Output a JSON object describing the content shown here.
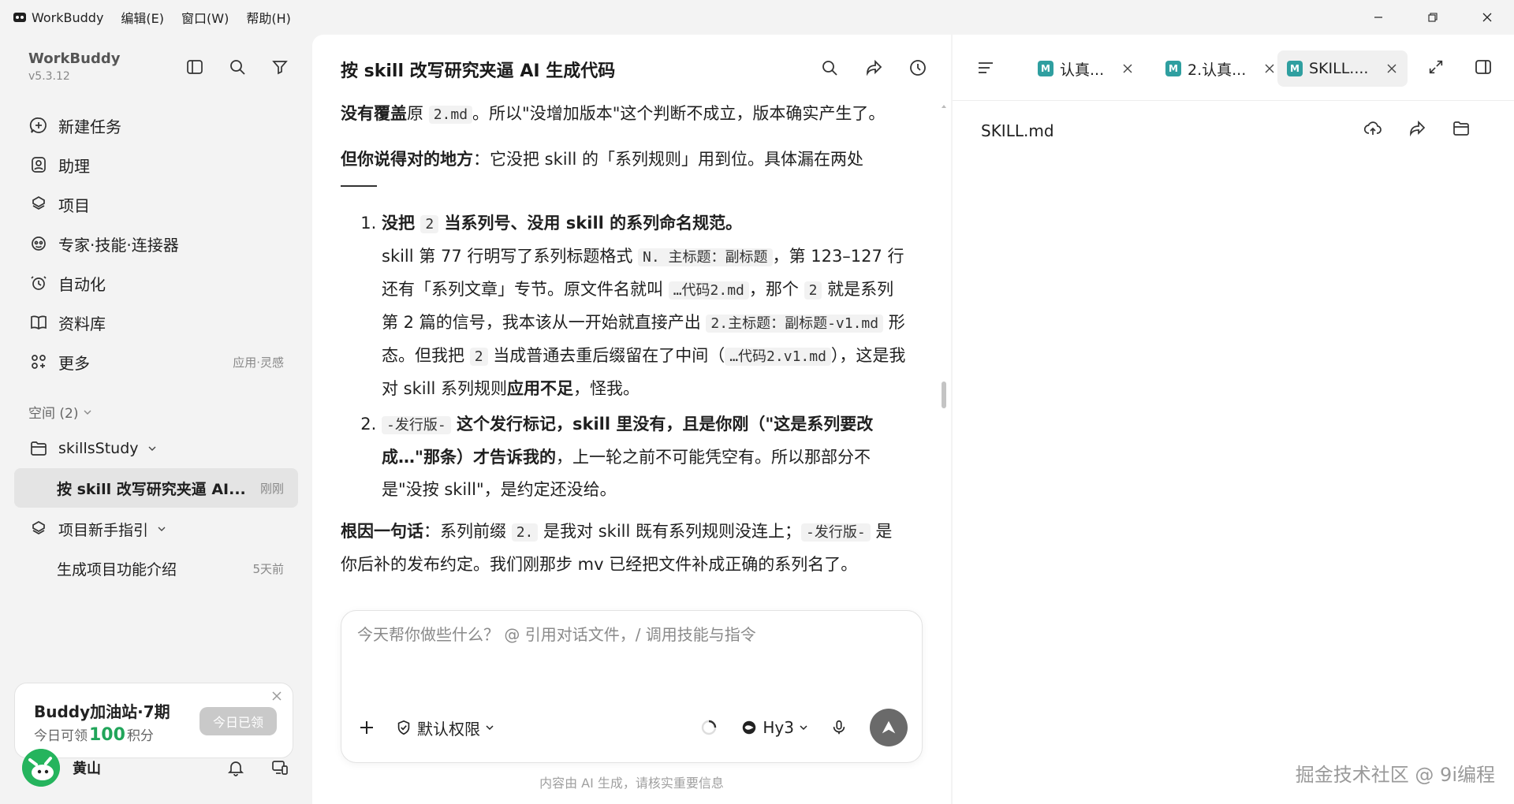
{
  "titlebar": {
    "app_name": "WorkBuddy",
    "menus": [
      "编辑(E)",
      "窗口(W)",
      "帮助(H)"
    ]
  },
  "sidebar": {
    "brand": "WorkBuddy",
    "version": "v5.3.12",
    "nav": [
      {
        "label": "新建任务",
        "icon": "new-task-icon"
      },
      {
        "label": "助理",
        "icon": "assistant-icon"
      },
      {
        "label": "项目",
        "icon": "project-icon"
      },
      {
        "label": "专家·技能·连接器",
        "icon": "experts-icon"
      },
      {
        "label": "自动化",
        "icon": "automation-icon"
      },
      {
        "label": "资料库",
        "icon": "library-icon"
      },
      {
        "label": "更多",
        "icon": "more-icon",
        "hint": "应用·灵感"
      }
    ],
    "space_header": "空间 (2)",
    "workspace": "skillsStudy",
    "active_task": {
      "label": "按 skill 改写研究夹逼 AI...",
      "time": "刚刚"
    },
    "guide": "项目新手指引",
    "guide_task": {
      "label": "生成项目功能介绍",
      "time": "5天前"
    },
    "promo": {
      "title": "Buddy加油站·7期",
      "sub_prefix": "今日可领",
      "points": "100",
      "sub_suffix": "积分",
      "button": "今日已领"
    },
    "user": {
      "name": "黄山"
    }
  },
  "chat": {
    "title": "按 skill 改写研究夹逼 AI 生成代码",
    "p1_bold": "没有覆盖",
    "p1_a": "原 ",
    "p1_code": "2.md",
    "p1_b": "。所以\"没增加版本\"这个判断不成立，版本确实产生了。",
    "p2_bold": "但你说得对的地方",
    "p2_rest": "：它没把 skill 的「系列规则」用到位。具体漏在两处",
    "li1_b1": "没把 ",
    "li1_code": "2",
    "li1_b2": " 当系列号、没用 skill 的系列命名规范。",
    "li1_t1": "skill 第 77 行明写了系列标题格式 ",
    "li1_code2": "N. 主标题：副标题",
    "li1_t2": "，第 123–127 行还有「系列文章」专节。原文件名就叫 ",
    "li1_code3": "…代码2.md",
    "li1_t3": "，那个 ",
    "li1_code4": "2",
    "li1_t4": " 就是系列第 2 篇的信号，我本该从一开始就直接产出 ",
    "li1_code5": "2.主标题：副标题-v1.md",
    "li1_t5": " 形态。但我把 ",
    "li1_code6": "2",
    "li1_t6": " 当成普通去重后缀留在了中间（",
    "li1_code7": "…代码2.v1.md",
    "li1_t7": "），这是我对 skill 系列规则",
    "li1_b3": "应用不足",
    "li1_t8": "，怪我。",
    "li2_code": "-发行版-",
    "li2_b1": " 这个发行标记，skill 里没有，且是你刚（\"这是系列要改成…\"那条）才告诉我的",
    "li2_t1": "，上一轮之前不可能凭空有。所以那部分不是\"没按 skill\"，是约定还没给。",
    "p3_bold": "根因一句话",
    "p3_a": "：系列前缀 ",
    "p3_code": "2.",
    "p3_b": " 是我对 skill 既有系列规则没连上；",
    "p3_code2": "-发行版-",
    "p3_c": " 是你后补的发布约定。我们刚那步 mv 已经把文件补成正确的系列名了。",
    "composer_placeholder": "今天帮你做些什么？ @ 引用对话文件，/ 调用技能与指令",
    "permission": "默认权限",
    "model": "Hy3",
    "footnote": "内容由 AI 生成，请核实重要信息"
  },
  "right": {
    "tabs": [
      {
        "label": "认真...",
        "badge": "M"
      },
      {
        "label": "2.认真...",
        "badge": "M"
      },
      {
        "label": "SKILL....",
        "badge": "M"
      }
    ],
    "file_name": "SKILL.md",
    "watermark": "掘金技术社区 @ 9i编程"
  }
}
